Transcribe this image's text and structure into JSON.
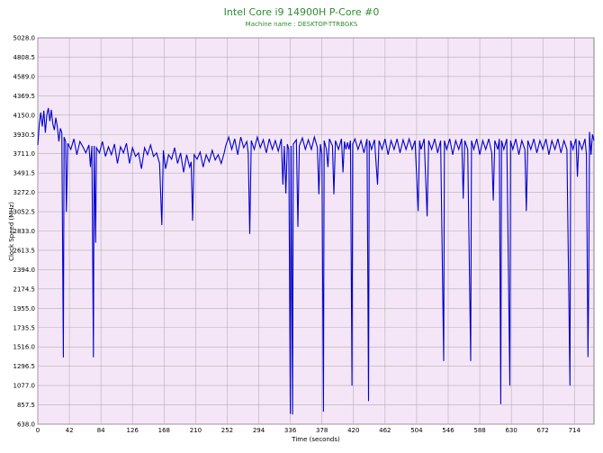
{
  "chart_data": {
    "type": "line",
    "title": "Intel Core i9 14900H P-Core #0",
    "subtitle": "Machine name : DESKTOP-TTRBGKS",
    "xlabel": "Time (seconds)",
    "ylabel": "Clock Speed (MHz)",
    "xlim": [
      0,
      740
    ],
    "ylim": [
      638.0,
      5028.0
    ],
    "x_ticks": [
      "0",
      "42",
      "84",
      "126",
      "168",
      "210",
      "252",
      "294",
      "336",
      "378",
      "420",
      "462",
      "504",
      "546",
      "588",
      "630",
      "672",
      "714"
    ],
    "y_ticks": [
      "638.0",
      "857.5",
      "1077.0",
      "1296.5",
      "1516.0",
      "1735.5",
      "1955.0",
      "2174.5",
      "2394.0",
      "2613.5",
      "2833.0",
      "3052.5",
      "3272.0",
      "3491.5",
      "3711.0",
      "3930.5",
      "4150.0",
      "4369.5",
      "4589.0",
      "4808.5",
      "5028.0"
    ],
    "grid": true,
    "colors": {
      "line": "#0000cc",
      "plot_bg": "#f5e6f7",
      "grid": "#b0b0b0",
      "title": "#2e8b2e"
    },
    "series": [
      {
        "values": [
          [
            0,
            3810
          ],
          [
            2,
            4050
          ],
          [
            4,
            4180
          ],
          [
            6,
            4020
          ],
          [
            8,
            4200
          ],
          [
            10,
            3950
          ],
          [
            12,
            4150
          ],
          [
            14,
            4230
          ],
          [
            16,
            4080
          ],
          [
            18,
            4210
          ],
          [
            20,
            4050
          ],
          [
            22,
            3980
          ],
          [
            24,
            4120
          ],
          [
            26,
            4020
          ],
          [
            28,
            3850
          ],
          [
            30,
            4000
          ],
          [
            32,
            3950
          ],
          [
            34,
            1396
          ],
          [
            35,
            3900
          ],
          [
            37,
            3850
          ],
          [
            38,
            3050
          ],
          [
            40,
            3830
          ],
          [
            44,
            3760
          ],
          [
            48,
            3880
          ],
          [
            52,
            3700
          ],
          [
            56,
            3850
          ],
          [
            60,
            3790
          ],
          [
            64,
            3720
          ],
          [
            68,
            3810
          ],
          [
            70,
            3560
          ],
          [
            72,
            3800
          ],
          [
            74,
            1398
          ],
          [
            75,
            3800
          ],
          [
            77,
            2700
          ],
          [
            78,
            3780
          ],
          [
            82,
            3720
          ],
          [
            86,
            3850
          ],
          [
            90,
            3680
          ],
          [
            94,
            3790
          ],
          [
            98,
            3700
          ],
          [
            102,
            3820
          ],
          [
            106,
            3600
          ],
          [
            110,
            3790
          ],
          [
            114,
            3720
          ],
          [
            118,
            3830
          ],
          [
            122,
            3600
          ],
          [
            126,
            3780
          ],
          [
            130,
            3680
          ],
          [
            134,
            3720
          ],
          [
            138,
            3540
          ],
          [
            142,
            3780
          ],
          [
            146,
            3700
          ],
          [
            150,
            3810
          ],
          [
            154,
            3680
          ],
          [
            158,
            3720
          ],
          [
            162,
            3600
          ],
          [
            165,
            2900
          ],
          [
            167,
            3750
          ],
          [
            170,
            3540
          ],
          [
            174,
            3700
          ],
          [
            178,
            3650
          ],
          [
            182,
            3780
          ],
          [
            186,
            3600
          ],
          [
            190,
            3720
          ],
          [
            194,
            3500
          ],
          [
            198,
            3700
          ],
          [
            202,
            3560
          ],
          [
            204,
            3620
          ],
          [
            206,
            2950
          ],
          [
            208,
            3700
          ],
          [
            212,
            3650
          ],
          [
            216,
            3730
          ],
          [
            220,
            3560
          ],
          [
            224,
            3700
          ],
          [
            228,
            3620
          ],
          [
            232,
            3750
          ],
          [
            236,
            3640
          ],
          [
            240,
            3700
          ],
          [
            244,
            3600
          ],
          [
            248,
            3720
          ],
          [
            250,
            3800
          ],
          [
            254,
            3900
          ],
          [
            258,
            3760
          ],
          [
            262,
            3880
          ],
          [
            266,
            3700
          ],
          [
            270,
            3900
          ],
          [
            274,
            3780
          ],
          [
            278,
            3850
          ],
          [
            280,
            3720
          ],
          [
            282,
            2800
          ],
          [
            284,
            3860
          ],
          [
            288,
            3760
          ],
          [
            292,
            3900
          ],
          [
            296,
            3780
          ],
          [
            300,
            3870
          ],
          [
            304,
            3720
          ],
          [
            308,
            3880
          ],
          [
            312,
            3760
          ],
          [
            316,
            3860
          ],
          [
            320,
            3740
          ],
          [
            324,
            3880
          ],
          [
            326,
            3360
          ],
          [
            328,
            3800
          ],
          [
            330,
            3260
          ],
          [
            332,
            3820
          ],
          [
            334,
            3760
          ],
          [
            336,
            755
          ],
          [
            337,
            3800
          ],
          [
            339,
            748
          ],
          [
            340,
            3820
          ],
          [
            344,
            3870
          ],
          [
            346,
            2880
          ],
          [
            348,
            3800
          ],
          [
            352,
            3890
          ],
          [
            356,
            3760
          ],
          [
            360,
            3870
          ],
          [
            364,
            3760
          ],
          [
            368,
            3900
          ],
          [
            372,
            3780
          ],
          [
            374,
            3250
          ],
          [
            376,
            3820
          ],
          [
            378,
            3700
          ],
          [
            380,
            780
          ],
          [
            381,
            3860
          ],
          [
            384,
            3760
          ],
          [
            386,
            3560
          ],
          [
            388,
            3880
          ],
          [
            392,
            3800
          ],
          [
            394,
            3250
          ],
          [
            396,
            3860
          ],
          [
            400,
            3760
          ],
          [
            404,
            3880
          ],
          [
            406,
            3500
          ],
          [
            408,
            3850
          ],
          [
            410,
            3760
          ],
          [
            412,
            3840
          ],
          [
            414,
            3760
          ],
          [
            416,
            3860
          ],
          [
            418,
            1077
          ],
          [
            419,
            3820
          ],
          [
            422,
            3880
          ],
          [
            426,
            3760
          ],
          [
            430,
            3860
          ],
          [
            434,
            3720
          ],
          [
            438,
            3880
          ],
          [
            440,
            900
          ],
          [
            441,
            3860
          ],
          [
            444,
            3760
          ],
          [
            448,
            3870
          ],
          [
            452,
            3360
          ],
          [
            454,
            3860
          ],
          [
            458,
            3760
          ],
          [
            462,
            3880
          ],
          [
            466,
            3700
          ],
          [
            470,
            3860
          ],
          [
            474,
            3760
          ],
          [
            478,
            3880
          ],
          [
            482,
            3720
          ],
          [
            486,
            3870
          ],
          [
            490,
            3760
          ],
          [
            494,
            3880
          ],
          [
            498,
            3760
          ],
          [
            502,
            3860
          ],
          [
            506,
            3060
          ],
          [
            508,
            3860
          ],
          [
            510,
            3760
          ],
          [
            514,
            3880
          ],
          [
            518,
            3000
          ],
          [
            520,
            3860
          ],
          [
            524,
            3760
          ],
          [
            528,
            3880
          ],
          [
            532,
            3720
          ],
          [
            536,
            3860
          ],
          [
            540,
            1355
          ],
          [
            541,
            3860
          ],
          [
            544,
            3760
          ],
          [
            548,
            3880
          ],
          [
            552,
            3700
          ],
          [
            556,
            3860
          ],
          [
            560,
            3760
          ],
          [
            564,
            3880
          ],
          [
            566,
            3200
          ],
          [
            568,
            3860
          ],
          [
            572,
            3760
          ],
          [
            576,
            1355
          ],
          [
            577,
            3860
          ],
          [
            580,
            3760
          ],
          [
            584,
            3880
          ],
          [
            588,
            3700
          ],
          [
            592,
            3860
          ],
          [
            596,
            3760
          ],
          [
            600,
            3880
          ],
          [
            604,
            3720
          ],
          [
            606,
            3180
          ],
          [
            608,
            3860
          ],
          [
            612,
            3760
          ],
          [
            614,
            3880
          ],
          [
            616,
            865
          ],
          [
            617,
            3860
          ],
          [
            620,
            3760
          ],
          [
            624,
            3880
          ],
          [
            628,
            1077
          ],
          [
            629,
            3860
          ],
          [
            632,
            3760
          ],
          [
            636,
            3880
          ],
          [
            640,
            3700
          ],
          [
            644,
            3860
          ],
          [
            648,
            3760
          ],
          [
            650,
            3060
          ],
          [
            652,
            3860
          ],
          [
            656,
            3760
          ],
          [
            660,
            3880
          ],
          [
            664,
            3720
          ],
          [
            668,
            3860
          ],
          [
            672,
            3760
          ],
          [
            676,
            3880
          ],
          [
            680,
            3700
          ],
          [
            684,
            3860
          ],
          [
            688,
            3760
          ],
          [
            692,
            3880
          ],
          [
            696,
            3720
          ],
          [
            700,
            3860
          ],
          [
            704,
            3760
          ],
          [
            708,
            1077
          ],
          [
            709,
            3860
          ],
          [
            712,
            3760
          ],
          [
            716,
            3880
          ],
          [
            718,
            3450
          ],
          [
            720,
            3860
          ],
          [
            724,
            3760
          ],
          [
            728,
            3880
          ],
          [
            730,
            3700
          ],
          [
            732,
            1400
          ],
          [
            733,
            2300
          ],
          [
            734,
            3960
          ],
          [
            736,
            3700
          ],
          [
            738,
            3930
          ],
          [
            740,
            3860
          ]
        ]
      }
    ]
  }
}
